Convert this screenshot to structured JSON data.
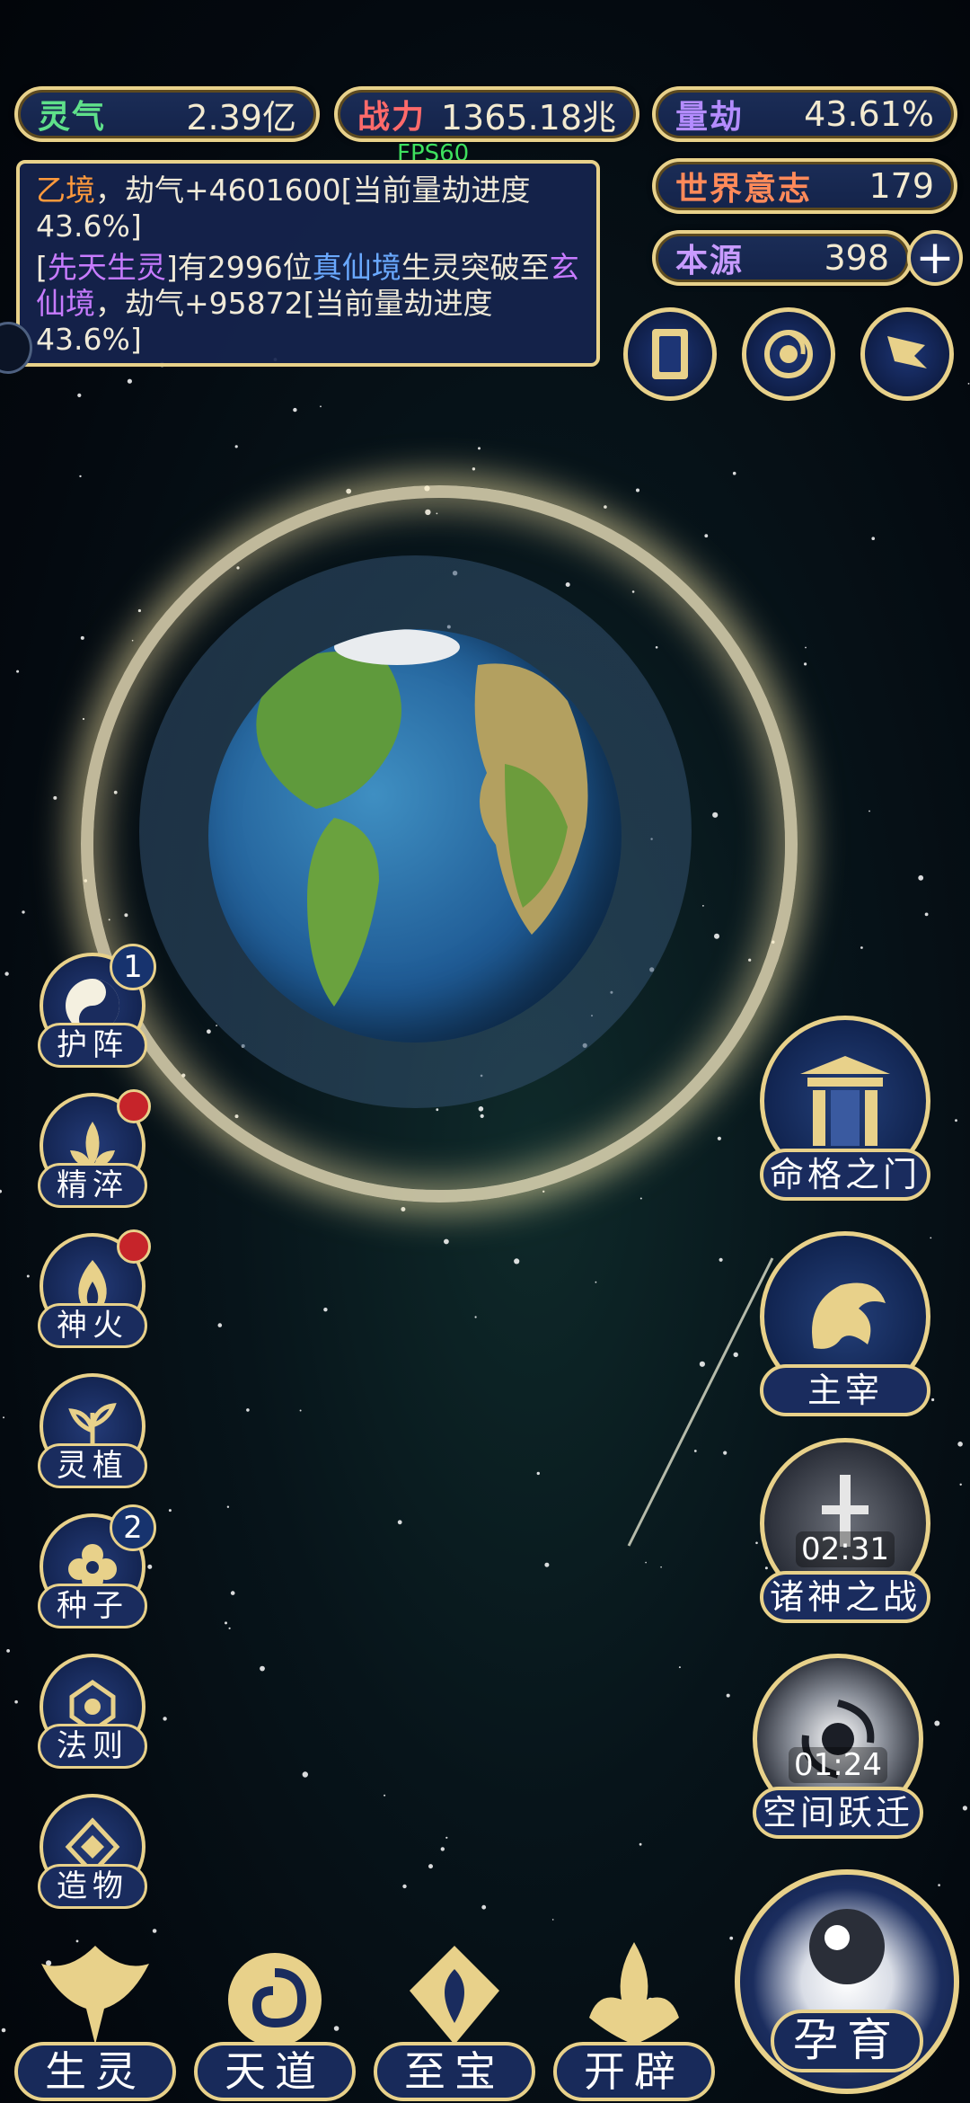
{
  "stats": {
    "lingqi": {
      "label": "灵气",
      "value": "2.39亿",
      "color": "#5fe08a"
    },
    "zhanli": {
      "label": "战力",
      "value": "1365.18兆",
      "color": "#ff6a6a"
    },
    "liangjie": {
      "label": "量劫",
      "value": "43.61%",
      "color": "#b48cff"
    },
    "shijie": {
      "label": "世界意志",
      "value": "179",
      "color": "#ff8a5a"
    },
    "benyuan": {
      "label": "本源",
      "value": "398",
      "color": "#c89bff"
    }
  },
  "fps": "FPS60",
  "log": {
    "line1": {
      "tag": "乙境",
      "text": "，劫气+4601600[当前量劫进度43.6%]"
    },
    "line2": {
      "p1": "[",
      "tag1": "先天生灵",
      "p2": "]有2996位",
      "tag2": "真仙境",
      "p3": "生灵突破至",
      "tag3": "玄仙境",
      "p4": "，劫气+95872[当前量劫进度43.6%]"
    },
    "colors": {
      "orange": "#ff9a3c",
      "purple": "#c77bff",
      "blue": "#6aa9ff"
    }
  },
  "top_icons": [
    {
      "name": "cards-icon"
    },
    {
      "name": "swirl-icon"
    },
    {
      "name": "flag-icon"
    }
  ],
  "left_menu": [
    {
      "key": "huzhen",
      "label": "护阵",
      "icon": "yin-yang-icon",
      "badge": "1"
    },
    {
      "key": "jingcui",
      "label": "精淬",
      "icon": "lotus-flame-icon",
      "dot": true
    },
    {
      "key": "shenhuo",
      "label": "神火",
      "icon": "flame-icon",
      "dot": true
    },
    {
      "key": "lingzhi",
      "label": "灵植",
      "icon": "plant-icon"
    },
    {
      "key": "zhongzi",
      "label": "种子",
      "icon": "seed-flower-icon",
      "badge": "2"
    },
    {
      "key": "faze",
      "label": "法则",
      "icon": "rune-icon"
    },
    {
      "key": "zaowu",
      "label": "造物",
      "icon": "diamond-icon"
    }
  ],
  "right_menu": [
    {
      "key": "mingge",
      "label": "命格之门",
      "icon": "gate-icon"
    },
    {
      "key": "zhuzai",
      "label": "主宰",
      "icon": "dragon-icon"
    },
    {
      "key": "zhushen",
      "label": "诸神之战",
      "icon": "sword-icon",
      "timer": "02:31"
    },
    {
      "key": "kongjian",
      "label": "空间跃迁",
      "icon": "vortex-icon",
      "timer": "01:24"
    }
  ],
  "bottom_nav": [
    {
      "key": "shengling",
      "label": "生灵",
      "icon": "phoenix-icon"
    },
    {
      "key": "tiandao",
      "label": "天道",
      "icon": "cloud-swirl-icon"
    },
    {
      "key": "zhibao",
      "label": "至宝",
      "icon": "treasure-icon"
    },
    {
      "key": "kaipi",
      "label": "开辟",
      "icon": "axe-flame-icon"
    }
  ],
  "nurture": {
    "label": "孕育",
    "icon": "embryo-icon"
  }
}
